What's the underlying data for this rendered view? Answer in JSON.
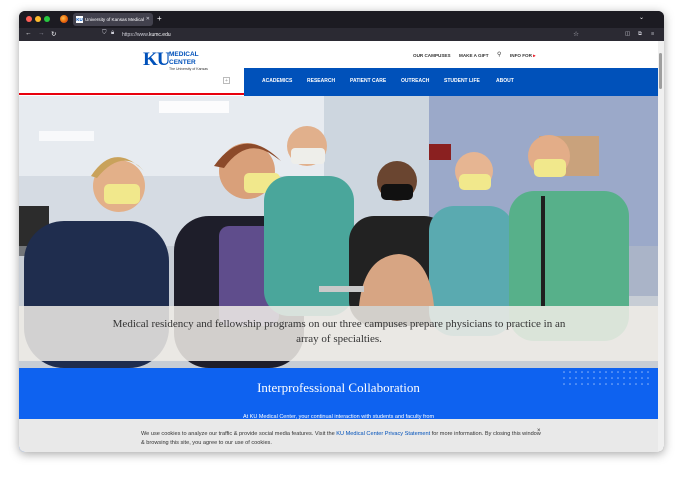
{
  "browser": {
    "tab_title": "University of Kansas Medical Ce",
    "tab_favicon": "KU",
    "new_tab": "+",
    "address_prefix": "https://www.",
    "address_domain": "kumc.edu"
  },
  "site": {
    "logo_mark": "KU",
    "logo_title_line1": "MEDICAL",
    "logo_title_line2": "CENTER",
    "logo_subtitle": "The University of Kansas",
    "utility_nav": [
      "OUR CAMPUSES",
      "MAKE A GIFT"
    ],
    "info_for": "INFO FOR",
    "main_nav": [
      "ACADEMICS",
      "RESEARCH",
      "PATIENT CARE",
      "OUTREACH",
      "STUDENT LIFE",
      "ABOUT"
    ]
  },
  "hero": {
    "caption": "Medical residency and fellowship programs on our three campuses prepare physicians to practice in an array of specialties."
  },
  "section": {
    "title": "Interprofessional Collaboration",
    "body": "At KU Medical Center, your continual interaction with students and faculty from"
  },
  "cookie_banner": {
    "text_before_link": "We use cookies to analyze our traffic & provide social media features. Visit the ",
    "link": "KU Medical Center Privacy Statement",
    "text_after_link": " for more information. By closing this window & browsing this site, you agree to our use of cookies.",
    "close": "×"
  },
  "colors": {
    "ku_blue": "#0051ba",
    "ku_red": "#e8000d",
    "section_blue": "#0e62f0"
  }
}
